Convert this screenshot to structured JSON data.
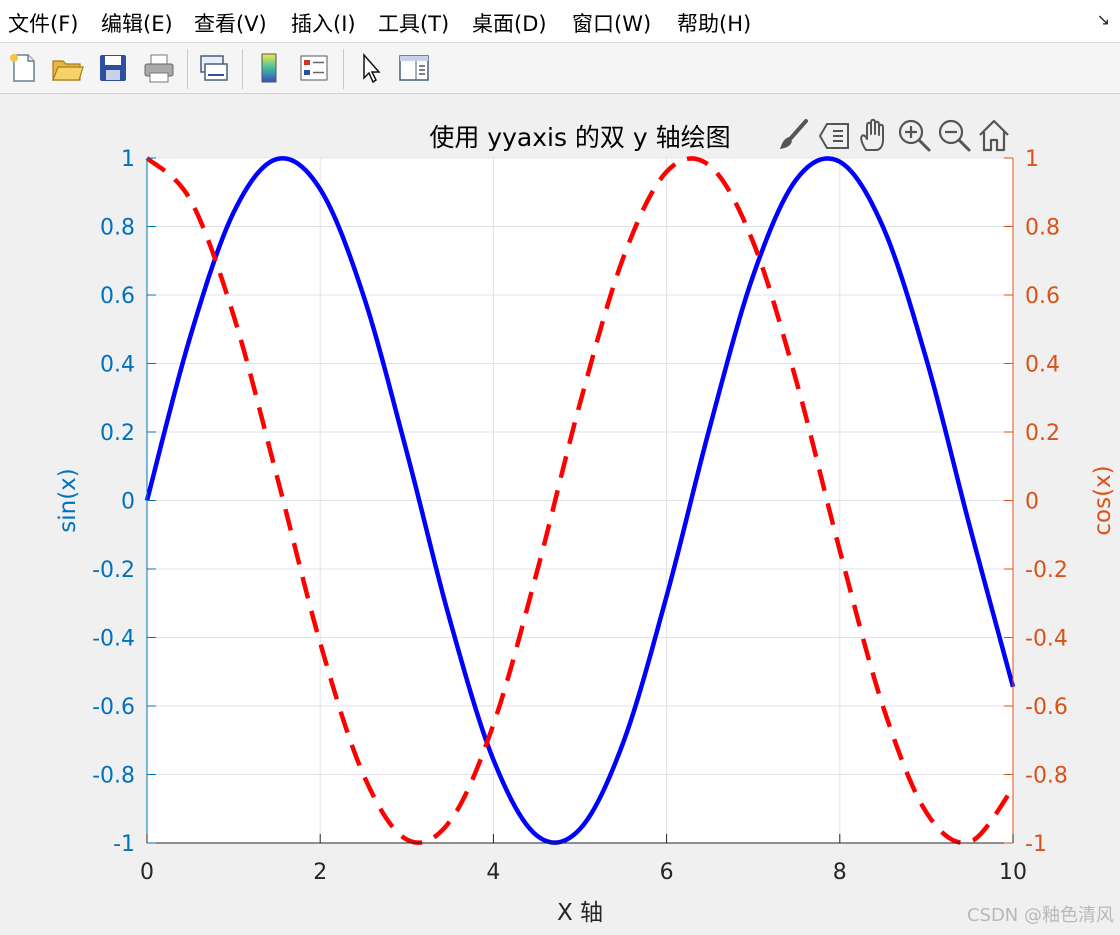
{
  "menubar": {
    "items": [
      "文件(F)",
      "编辑(E)",
      "查看(V)",
      "插入(I)",
      "工具(T)",
      "桌面(D)",
      "窗口(W)",
      "帮助(H)"
    ],
    "corner_icon": "dock-arrow-icon"
  },
  "toolbar": {
    "buttons": [
      "new-figure-icon",
      "open-file-icon",
      "save-icon",
      "print-icon",
      "link-plot-icon",
      "colorbar-icon",
      "legend-icon",
      "edit-plot-cursor-icon",
      "property-inspector-icon"
    ]
  },
  "axes_toolbar": {
    "tools": [
      "brush-icon",
      "data-tips-icon",
      "pan-hand-icon",
      "zoom-in-icon",
      "zoom-out-icon",
      "restore-view-home-icon"
    ]
  },
  "watermark": "CSDN @釉色清风",
  "colors": {
    "left_axis": "#0072BD",
    "right_axis": "#D95319",
    "sin_line": "#0000FF",
    "cos_line": "#FF0000"
  },
  "chart_data": {
    "type": "line",
    "title": "使用 yyaxis 的双 y 轴绘图",
    "xlabel": "X 轴",
    "ylabel_left": "sin(x)",
    "ylabel_right": "cos(x)",
    "xlim": [
      0,
      10
    ],
    "ylim_left": [
      -1,
      1
    ],
    "ylim_right": [
      -1,
      1
    ],
    "x_ticks": [
      "0",
      "2",
      "4",
      "6",
      "8",
      "10"
    ],
    "y_ticks_left": [
      "-1",
      "-0.8",
      "-0.6",
      "-0.4",
      "-0.2",
      "0",
      "0.2",
      "0.4",
      "0.6",
      "0.8",
      "1"
    ],
    "y_ticks_right": [
      "-1",
      "-0.8",
      "-0.6",
      "-0.4",
      "-0.2",
      "0",
      "0.2",
      "0.4",
      "0.6",
      "0.8",
      "1"
    ],
    "grid": true,
    "series": [
      {
        "axis": "left",
        "style": "solid",
        "x": [
          0,
          0.5,
          1,
          1.5,
          2,
          2.5,
          3,
          3.5,
          4,
          4.5,
          5,
          5.5,
          6,
          6.5,
          7,
          7.5,
          8,
          8.5,
          9,
          9.5,
          10
        ],
        "y": [
          0,
          0.479,
          0.841,
          0.997,
          0.909,
          0.598,
          0.141,
          -0.351,
          -0.757,
          -0.978,
          -0.959,
          -0.706,
          -0.279,
          0.215,
          0.657,
          0.938,
          0.989,
          0.798,
          0.412,
          -0.075,
          -0.544
        ]
      },
      {
        "axis": "right",
        "style": "dashed",
        "x": [
          0,
          0.5,
          1,
          1.5,
          2,
          2.5,
          3,
          3.5,
          4,
          4.5,
          5,
          5.5,
          6,
          6.5,
          7,
          7.5,
          8,
          8.5,
          9,
          9.5,
          10
        ],
        "y": [
          1,
          0.878,
          0.54,
          0.071,
          -0.416,
          -0.801,
          -0.99,
          -0.936,
          -0.654,
          -0.211,
          0.284,
          0.709,
          0.96,
          0.977,
          0.754,
          0.347,
          -0.146,
          -0.602,
          -0.911,
          -0.997,
          -0.839
        ]
      }
    ]
  }
}
